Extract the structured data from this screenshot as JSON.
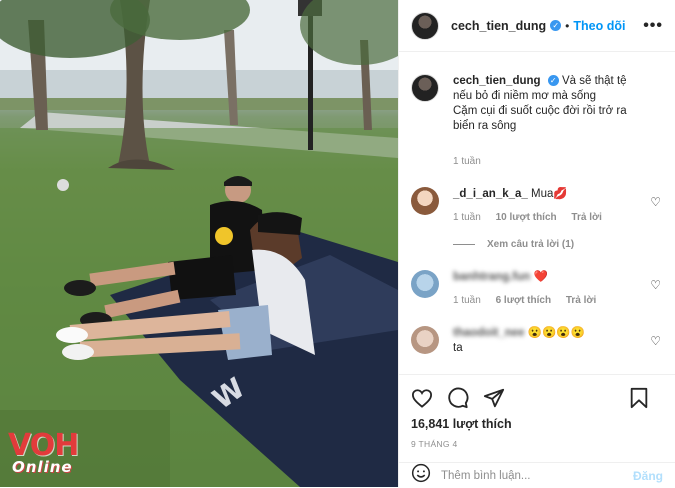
{
  "watermark": {
    "main": "VOH",
    "sub": "Online"
  },
  "header": {
    "username": "cech_tien_dung",
    "separator": "•",
    "follow_label": "Theo dõi",
    "more_label": "•••"
  },
  "caption": {
    "username": "cech_tien_dung",
    "text_line1": "Và sẽ thật tệ nếu bỏ đi niềm mơ mà sống",
    "text_line2": "Cặm cụi đi suốt cuộc đời rồi trở ra biển ra sông",
    "time": "1 tuần"
  },
  "comments": [
    {
      "username": "_d_i_an_k_a_",
      "text": "Mua💋",
      "time": "1 tuần",
      "likes": "10 lượt thích",
      "reply_label": "Trả lời",
      "view_replies": "Xem câu trả lời (1)"
    },
    {
      "username": "banhtrang.fun",
      "text": "❤️",
      "time": "1 tuần",
      "likes": "6 lượt thích",
      "reply_label": "Trả lời"
    },
    {
      "username": "thaodoit_nee",
      "text": "😮😮😮😮",
      "text2": "ta"
    }
  ],
  "actions": {
    "likes": "16,841 lượt thích",
    "date": "9 THÁNG 4"
  },
  "add_comment": {
    "placeholder": "Thêm bình luận...",
    "post_label": "Đăng"
  },
  "colors": {
    "link": "#0095f6",
    "verified": "#3897f0",
    "post_disabled": "#b2dffc",
    "watermark": "#e23b3b"
  }
}
